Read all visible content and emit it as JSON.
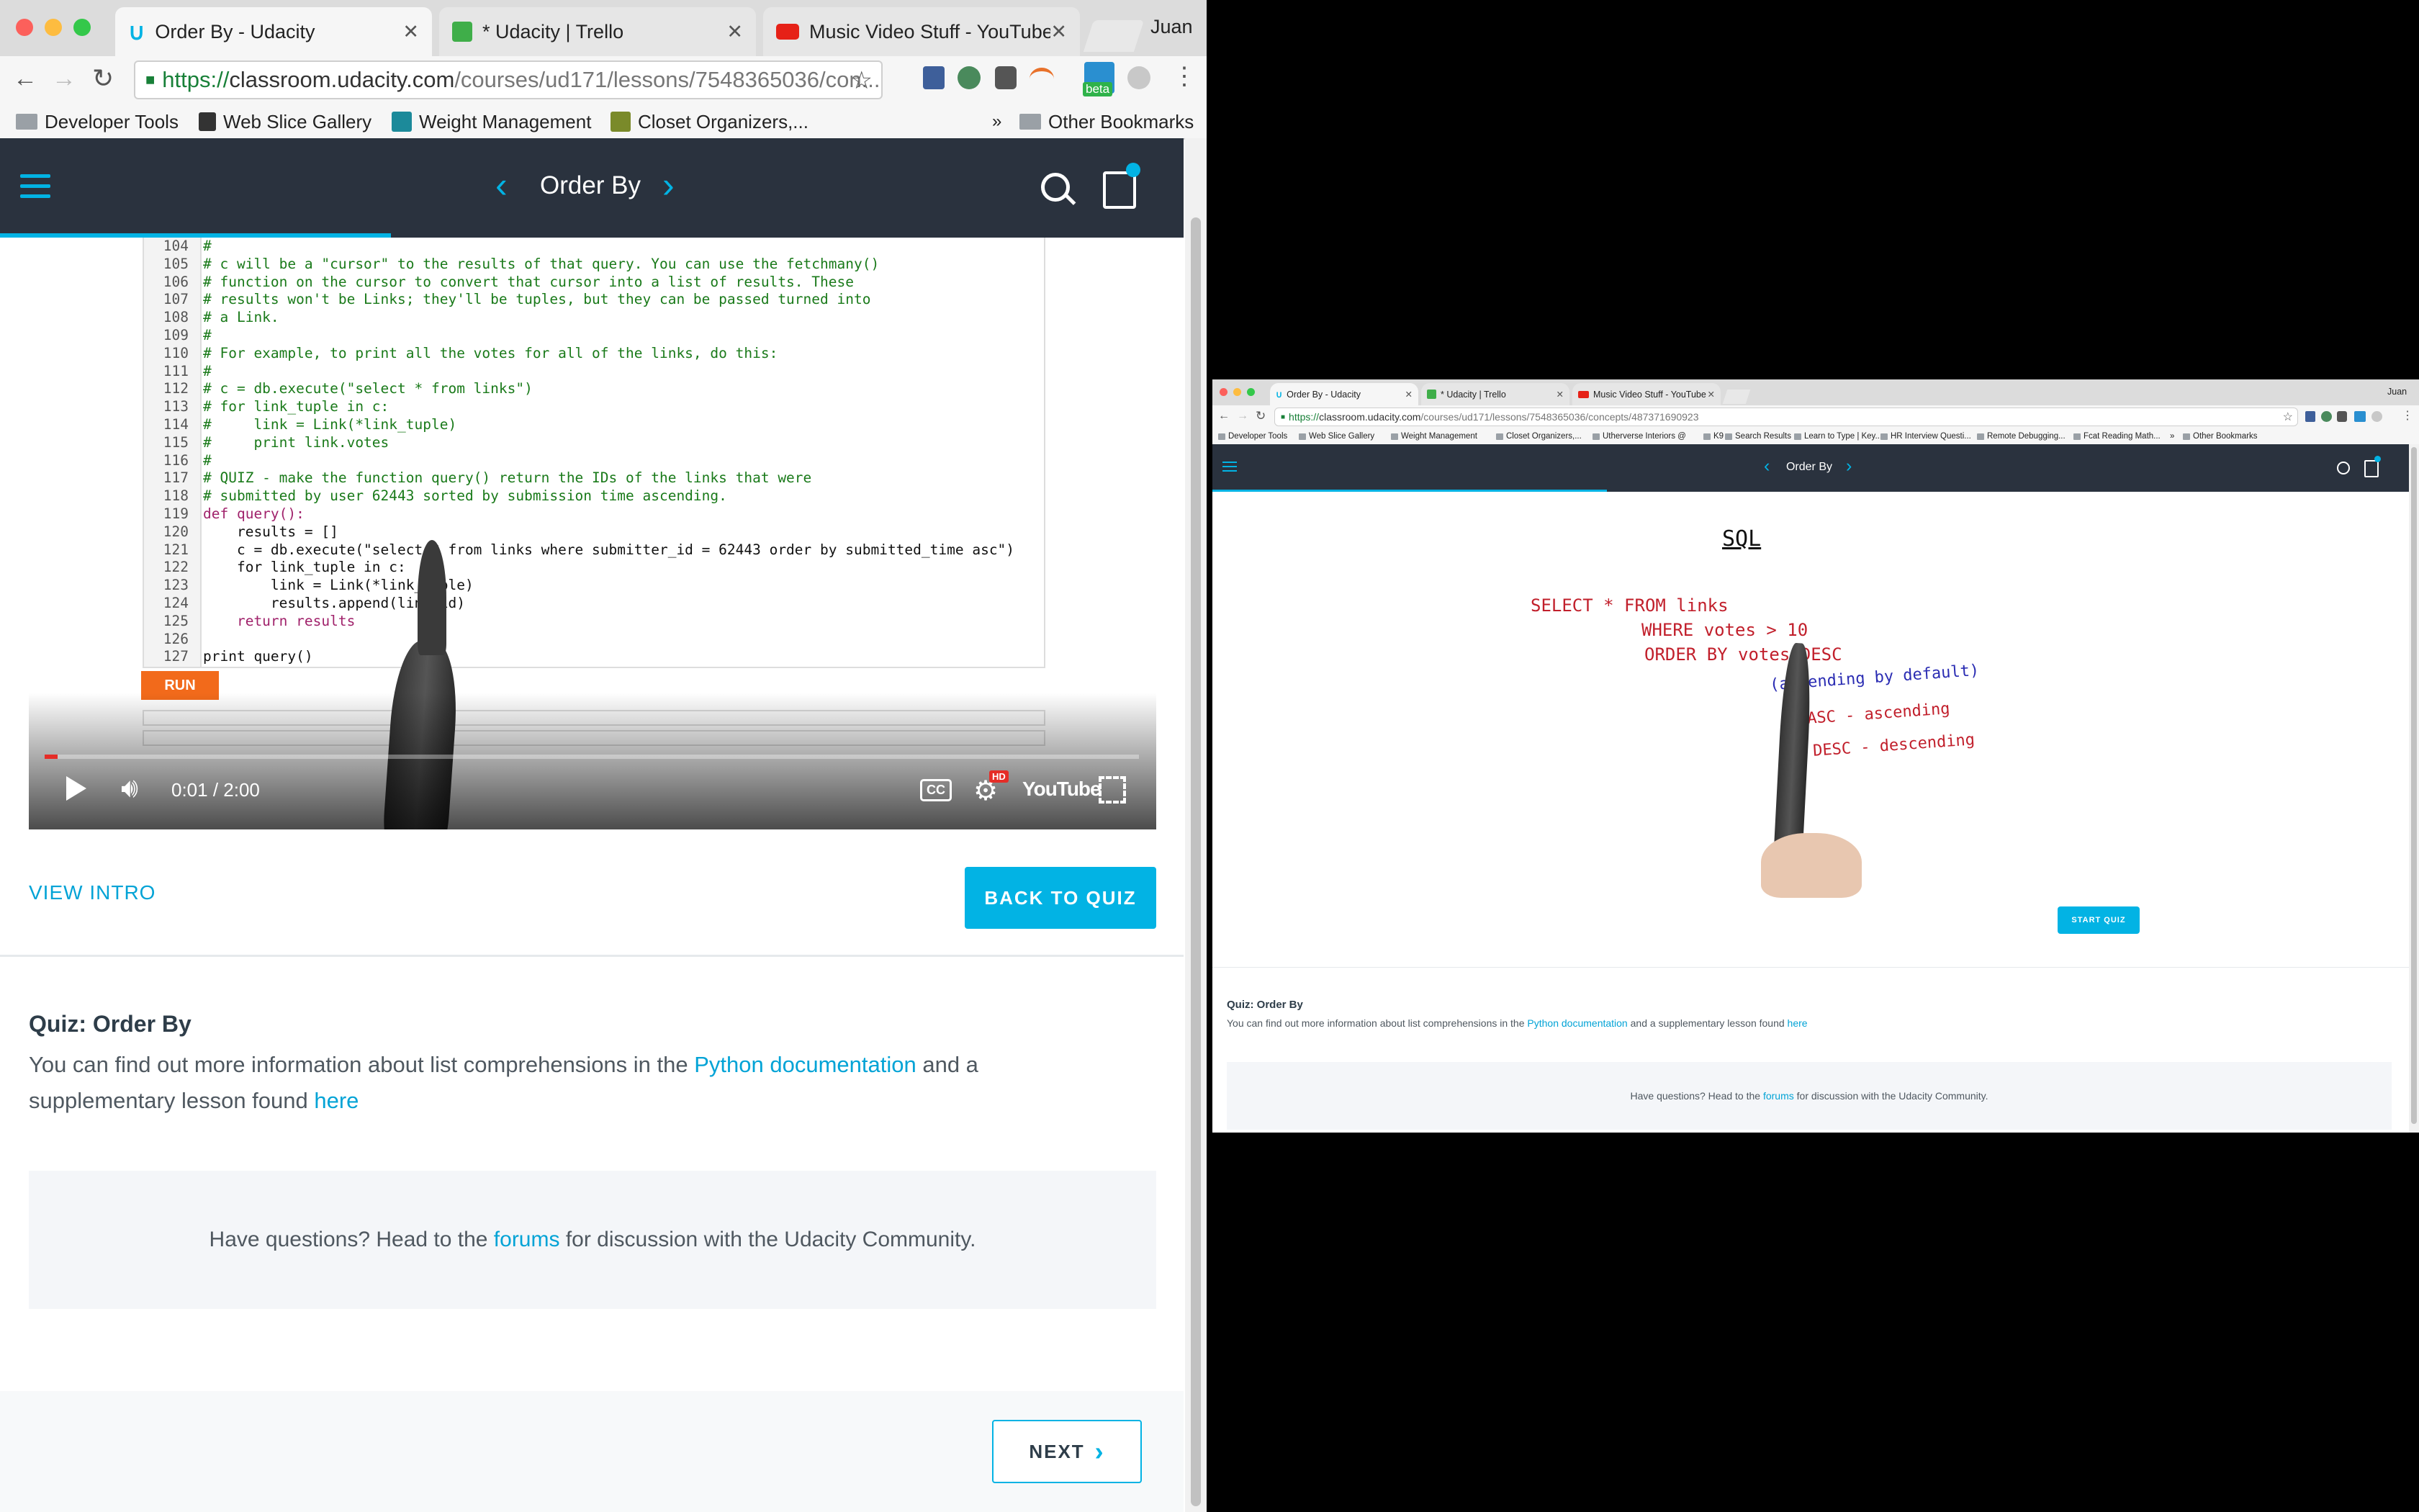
{
  "system": {
    "user_name": "Juan"
  },
  "browser": {
    "tabs": [
      {
        "title": "Order By - Udacity",
        "icon": "udacity-icon",
        "active": true
      },
      {
        "title": "* Udacity | Trello",
        "icon": "trello-icon",
        "active": false
      },
      {
        "title": "Music Video Stuff - YouTube",
        "icon": "youtube-icon",
        "active": false
      }
    ],
    "url_left": {
      "scheme": "https://",
      "host": "classroom.udacity.com",
      "path": "/courses/ud171/lessons/7548365036/con..."
    },
    "url_right": {
      "scheme": "https://",
      "host": "classroom.udacity.com",
      "path": "/courses/ud171/lessons/7548365036/concepts/487371690923"
    },
    "extension_badge": "beta",
    "bookmarks_left": [
      "Developer Tools",
      "Web Slice Gallery",
      "Weight Management",
      "Closet Organizers,...",
      "»",
      "Other Bookmarks"
    ],
    "bookmarks_right": [
      "Developer Tools",
      "Web Slice Gallery",
      "Weight Management",
      "Closet Organizers,...",
      "Utherverse Interiors @",
      "K9",
      "Search Results",
      "Learn to Type | Key...",
      "HR Interview Questi...",
      "Remote Debugging...",
      "Fcat Reading Math...",
      "»",
      "Other Bookmarks"
    ]
  },
  "udacity": {
    "lesson_title": "Order By",
    "progress_fraction": 0.33,
    "video": {
      "time": "0:01 / 2:00",
      "played_fraction": 0.012,
      "cc_label": "CC",
      "hd_badge": "HD",
      "youtube_logo": "YouTube",
      "run_label": "RUN"
    },
    "code_lines": [
      {
        "n": "104",
        "t": "#"
      },
      {
        "n": "105",
        "t": "# c will be a \"cursor\" to the results of that query. You can use the fetchmany()"
      },
      {
        "n": "106",
        "t": "# function on the cursor to convert that cursor into a list of results. These"
      },
      {
        "n": "107",
        "t": "# results won't be Links; they'll be tuples, but they can be passed turned into"
      },
      {
        "n": "108",
        "t": "# a Link."
      },
      {
        "n": "109",
        "t": "#"
      },
      {
        "n": "110",
        "t": "# For example, to print all the votes for all of the links, do this:"
      },
      {
        "n": "111",
        "t": "#"
      },
      {
        "n": "112",
        "t": "# c = db.execute(\"select * from links\")"
      },
      {
        "n": "113",
        "t": "# for link_tuple in c:"
      },
      {
        "n": "114",
        "t": "#     link = Link(*link_tuple)"
      },
      {
        "n": "115",
        "t": "#     print link.votes"
      },
      {
        "n": "116",
        "t": "#"
      },
      {
        "n": "117",
        "t": "# QUIZ - make the function query() return the IDs of the links that were"
      },
      {
        "n": "118",
        "t": "# submitted by user 62443 sorted by submission time ascending."
      },
      {
        "n": "119",
        "t": "def query():"
      },
      {
        "n": "120",
        "t": "    results = []"
      },
      {
        "n": "121",
        "t": "    c = db.execute(\"select * from links where submitter_id = 62443 order by submitted_time asc\")"
      },
      {
        "n": "122",
        "t": "    for link_tuple in c:"
      },
      {
        "n": "123",
        "t": "        link = Link(*link_tuple)"
      },
      {
        "n": "124",
        "t": "        results.append(link.id)"
      },
      {
        "n": "125",
        "t": "    return results"
      },
      {
        "n": "126",
        "t": ""
      },
      {
        "n": "127",
        "t": "print query()"
      }
    ],
    "view_intro": "VIEW INTRO",
    "back_to_quiz": "BACK TO QUIZ",
    "start_quiz": "START QUIZ",
    "quiz_title": "Quiz: Order By",
    "quiz_text_1": "You can find out more information about list comprehensions in the ",
    "quiz_link_1": "Python documentation",
    "quiz_text_2": " and a supplementary lesson found ",
    "quiz_link_2": "here",
    "forum_text_1": "Have questions? Head to the ",
    "forum_link": "forums",
    "forum_text_2": " for discussion with the Udacity Community.",
    "next": "NEXT",
    "whiteboard": {
      "title": "SQL",
      "line1": "SELECT * FROM links",
      "line2": "WHERE votes > 10",
      "line3": "ORDER BY votes DESC",
      "note": "(ascending by default)",
      "asc": "ASC - ascending",
      "desc": "DESC - descending"
    }
  }
}
